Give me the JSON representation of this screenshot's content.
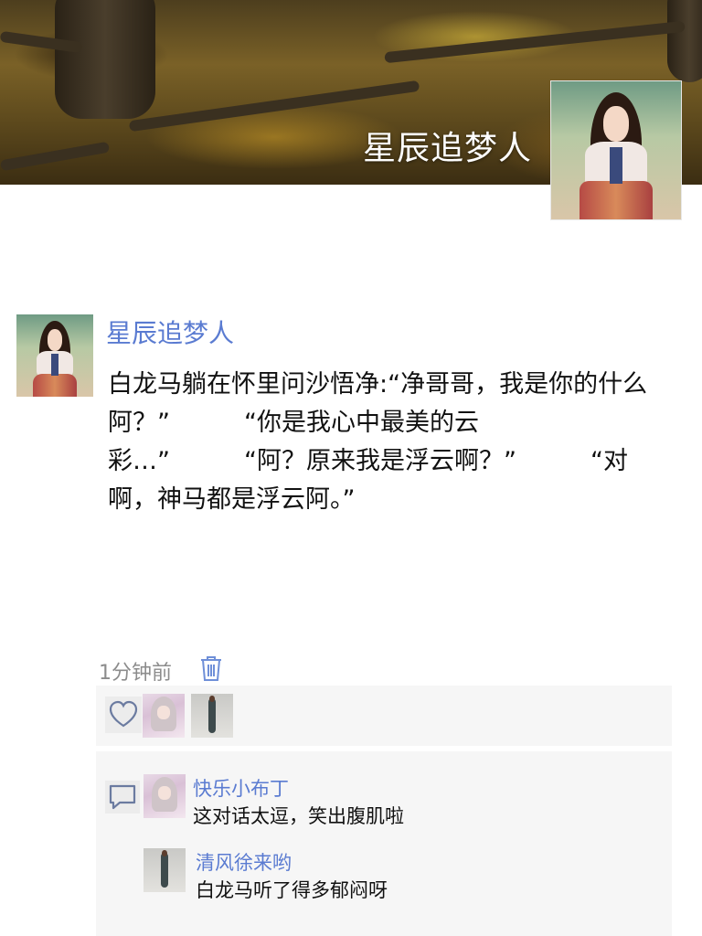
{
  "header": {
    "profile_name": "星辰追梦人"
  },
  "post": {
    "author": "星辰追梦人",
    "content": "白龙马躺在怀里问沙悟净:“净哥哥，我是你的什么阿？”　　　“你是我心中最美的云彩…”　　　“阿？原来我是浮云啊？”　　　“对啊，神马都是浮云阿。”",
    "time": "1分钟前"
  },
  "likes": {
    "icon": "heart-outline-icon"
  },
  "comments": [
    {
      "author": "快乐小布丁",
      "text": "这对话太逗，笑出腹肌啦"
    },
    {
      "author": "清风徐来哟",
      "text": "白龙马听了得多郁闷呀"
    }
  ],
  "colors": {
    "link": "#5a7bd1",
    "meta": "#8c8c8c",
    "panel": "#f6f6f6"
  }
}
